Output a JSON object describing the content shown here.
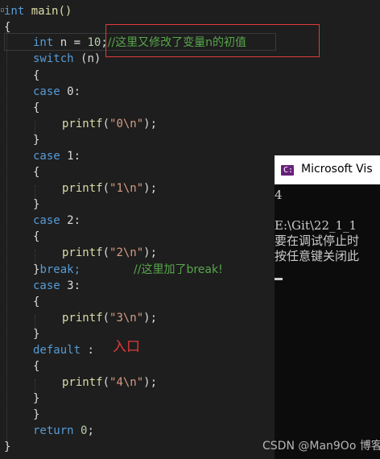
{
  "code": {
    "line_main": {
      "type": "int",
      "name": "main()"
    },
    "open_brace": "{",
    "line_decl": {
      "type": "int",
      "rest_a": "n = ",
      "num": "10",
      "rest_b": ";",
      "comment": "//这里又修改了变量n的初值"
    },
    "line_switch": {
      "kw": "switch",
      "rest": "(n)"
    },
    "brace_open": "{",
    "brace_close": "}",
    "case0": {
      "kw": "case",
      "label": "0:"
    },
    "case1": {
      "kw": "case",
      "label": "1:"
    },
    "case2": {
      "kw": "case",
      "label": "2:"
    },
    "case3": {
      "kw": "case",
      "label": "3:"
    },
    "printf": "printf",
    "str0": "\"0\\n\"",
    "str1": "\"1\\n\"",
    "str2": "\"2\\n\"",
    "str3": "\"3\\n\"",
    "str4": "\"4\\n\"",
    "paren_open": "(",
    "paren_close": ");",
    "break_line": {
      "brace": "}",
      "kw": "break;",
      "comment": "//这里加了break!"
    },
    "default_line": {
      "kw": "default",
      "colon": " :"
    },
    "return_line": {
      "kw": "return",
      "num": "0",
      "semi": ";"
    },
    "final_brace": "}"
  },
  "annotation": {
    "entry_label": "入口"
  },
  "console": {
    "title": "Microsoft Vis",
    "logo_glyph": "C:\\",
    "lines": [
      "4",
      "",
      "E:\\Git\\22_1_1",
      "要在调试停止时",
      "按任意键关闭此"
    ]
  },
  "watermark": "CSDN @Man9Oo 博客"
}
